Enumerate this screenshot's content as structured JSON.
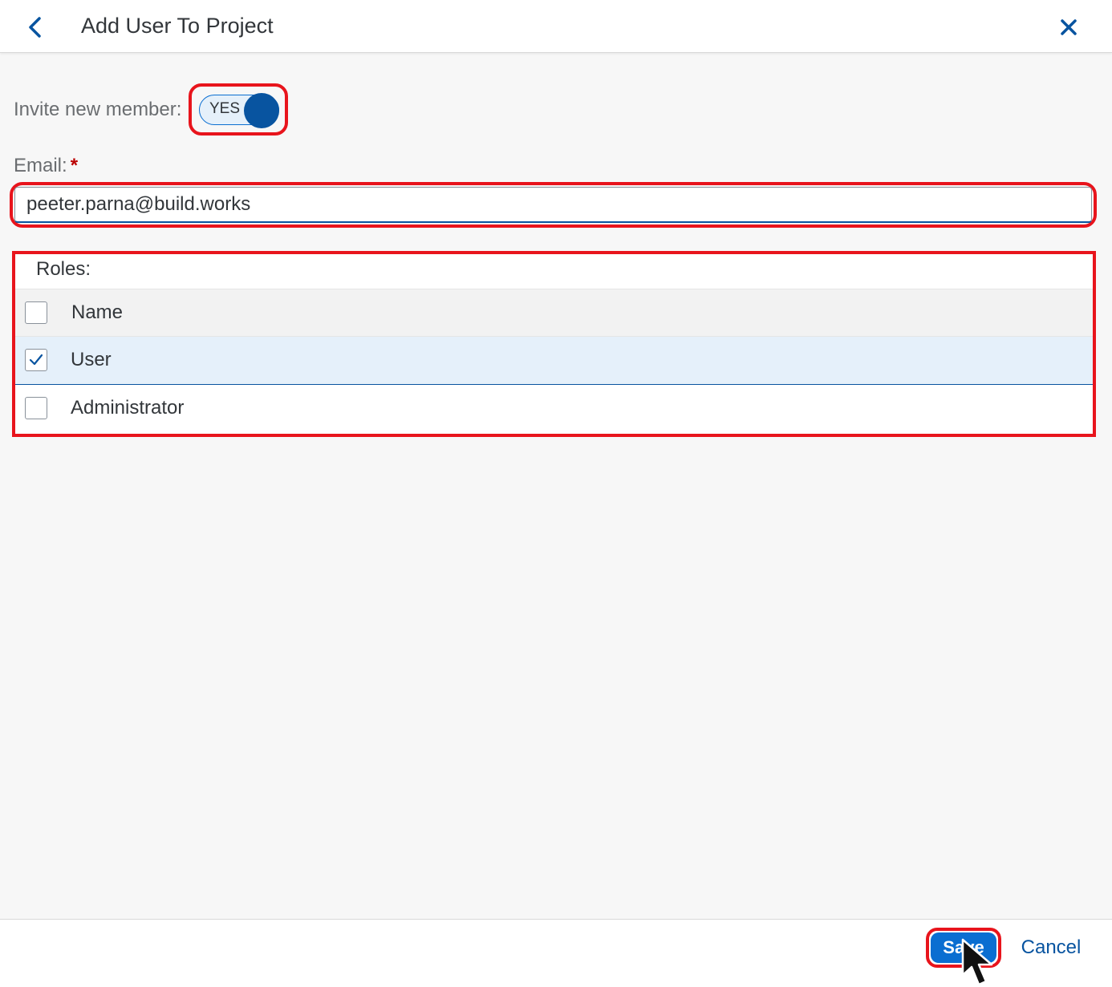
{
  "header": {
    "title": "Add User To Project",
    "back_icon": "chevron-left-icon",
    "close_icon": "close-icon"
  },
  "invite": {
    "label": "Invite new member:",
    "toggle_text": "YES",
    "toggle_on": true
  },
  "email": {
    "label": "Email:",
    "required_marker": "*",
    "value": "peeter.parna@build.works"
  },
  "roles": {
    "title": "Roles:",
    "column_header": "Name",
    "rows": [
      {
        "name": "User",
        "checked": true
      },
      {
        "name": "Administrator",
        "checked": false
      }
    ]
  },
  "footer": {
    "save_label": "Save",
    "cancel_label": "Cancel"
  },
  "colors": {
    "accent": "#0a6ed1",
    "accent_dark": "#0854a0",
    "highlight": "#e8141c",
    "selected_row": "#e5f0fa"
  }
}
